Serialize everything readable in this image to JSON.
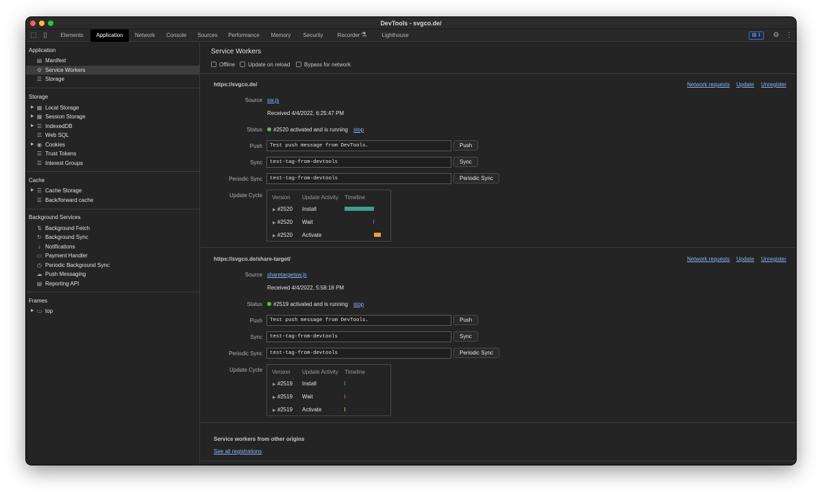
{
  "window": {
    "title": "DevTools - svgco.de/"
  },
  "tabs": [
    "Elements",
    "Application",
    "Network",
    "Console",
    "Sources",
    "Performance",
    "Memory",
    "Security",
    "Recorder",
    "Lighthouse"
  ],
  "issue_count": "1",
  "sidebar": {
    "application": {
      "header": "Application",
      "items": [
        "Manifest",
        "Service Workers",
        "Storage"
      ]
    },
    "storage": {
      "header": "Storage",
      "items": [
        "Local Storage",
        "Session Storage",
        "IndexedDB",
        "Web SQL",
        "Cookies",
        "Trust Tokens",
        "Interest Groups"
      ]
    },
    "cache": {
      "header": "Cache",
      "items": [
        "Cache Storage",
        "Back/forward cache"
      ]
    },
    "background": {
      "header": "Background Services",
      "items": [
        "Background Fetch",
        "Background Sync",
        "Notifications",
        "Payment Handler",
        "Periodic Background Sync",
        "Push Messaging",
        "Reporting API"
      ]
    },
    "frames": {
      "header": "Frames",
      "items": [
        "top"
      ]
    }
  },
  "main": {
    "title": "Service Workers",
    "options": [
      "Offline",
      "Update on reload",
      "Bypass for network"
    ],
    "labels": {
      "source": "Source",
      "status": "Status",
      "push": "Push",
      "sync": "Sync",
      "periodic": "Periodic Sync",
      "cycle": "Update Cycle"
    },
    "links": {
      "network": "Network requests",
      "update": "Update",
      "unregister": "Unregister",
      "stop": "stop"
    },
    "buttons": {
      "push": "Push",
      "sync": "Sync",
      "periodic": "Periodic Sync"
    },
    "cycle_headers": [
      "Version",
      "Update Activity",
      "Timeline"
    ],
    "workers": [
      {
        "origin": "https://svgco.de/",
        "source": "sw.js",
        "received": "Received 4/4/2022, 6:25:47 PM",
        "status": "#2520 activated and is running",
        "push_value": "Test push message from DevTools.",
        "sync_value": "test-tag-from-devtools",
        "periodic_value": "test-tag-from-devtools",
        "cycle": [
          {
            "version": "#2520",
            "activity": "Install"
          },
          {
            "version": "#2520",
            "activity": "Wait"
          },
          {
            "version": "#2520",
            "activity": "Activate"
          }
        ]
      },
      {
        "origin": "https://svgco.de/share-target/",
        "source": "sharetargetsw.js",
        "received": "Received 4/4/2022, 5:58:18 PM",
        "status": "#2519 activated and is running",
        "push_value": "Test push message from DevTools.",
        "sync_value": "test-tag-from-devtools",
        "periodic_value": "test-tag-from-devtools",
        "cycle": [
          {
            "version": "#2519",
            "activity": "Install"
          },
          {
            "version": "#2519",
            "activity": "Wait"
          },
          {
            "version": "#2519",
            "activity": "Activate"
          }
        ]
      }
    ],
    "other_origins": {
      "header": "Service workers from other origins",
      "link": "See all registrations"
    }
  },
  "colors": {
    "install": "#3f9e8c",
    "wait": "#9b59b6",
    "activate": "#f0a040",
    "running": "#5cb85c",
    "link": "#8ab4f8"
  }
}
